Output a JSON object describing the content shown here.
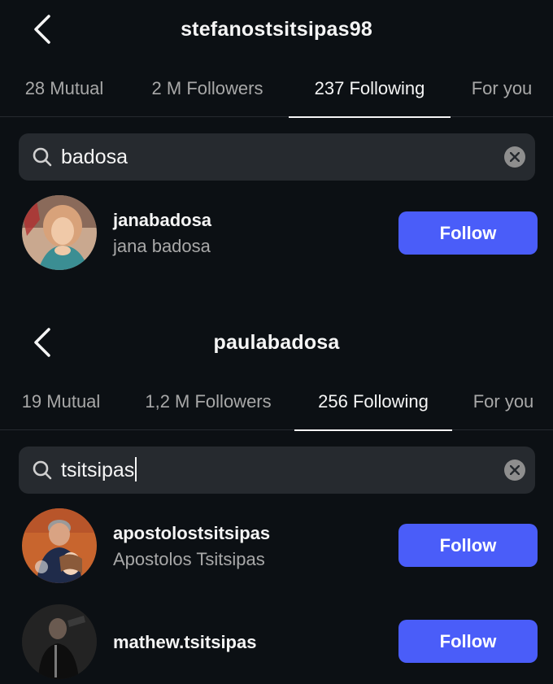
{
  "panels": [
    {
      "title": "stefanostsitsipas98",
      "tabs": [
        {
          "label": "28 Mutual",
          "active": false
        },
        {
          "label": "2 M Followers",
          "active": false
        },
        {
          "label": "237 Following",
          "active": true
        },
        {
          "label": "For you",
          "active": false
        }
      ],
      "search": {
        "value": "badosa"
      },
      "results": [
        {
          "username": "janabadosa",
          "fullname": "jana badosa",
          "button": "Follow"
        }
      ]
    },
    {
      "title": "paulabadosa",
      "tabs": [
        {
          "label": "19 Mutual",
          "active": false
        },
        {
          "label": "1,2 M Followers",
          "active": false
        },
        {
          "label": "256 Following",
          "active": true
        },
        {
          "label": "For you",
          "active": false
        }
      ],
      "search": {
        "value": "tsitsipas"
      },
      "results": [
        {
          "username": "apostolostsitsipas",
          "fullname": "Apostolos Tsitsipas",
          "button": "Follow"
        },
        {
          "username": "mathew.tsitsipas",
          "fullname": "",
          "button": "Follow"
        }
      ]
    }
  ],
  "icons": {
    "back": "chevron-left-icon",
    "search": "search-icon",
    "clear": "close-circle-icon"
  },
  "colors": {
    "background": "#0c1014",
    "search_bg": "#262a2f",
    "follow_button": "#4a5df9",
    "secondary_text": "#a8a8a8"
  }
}
